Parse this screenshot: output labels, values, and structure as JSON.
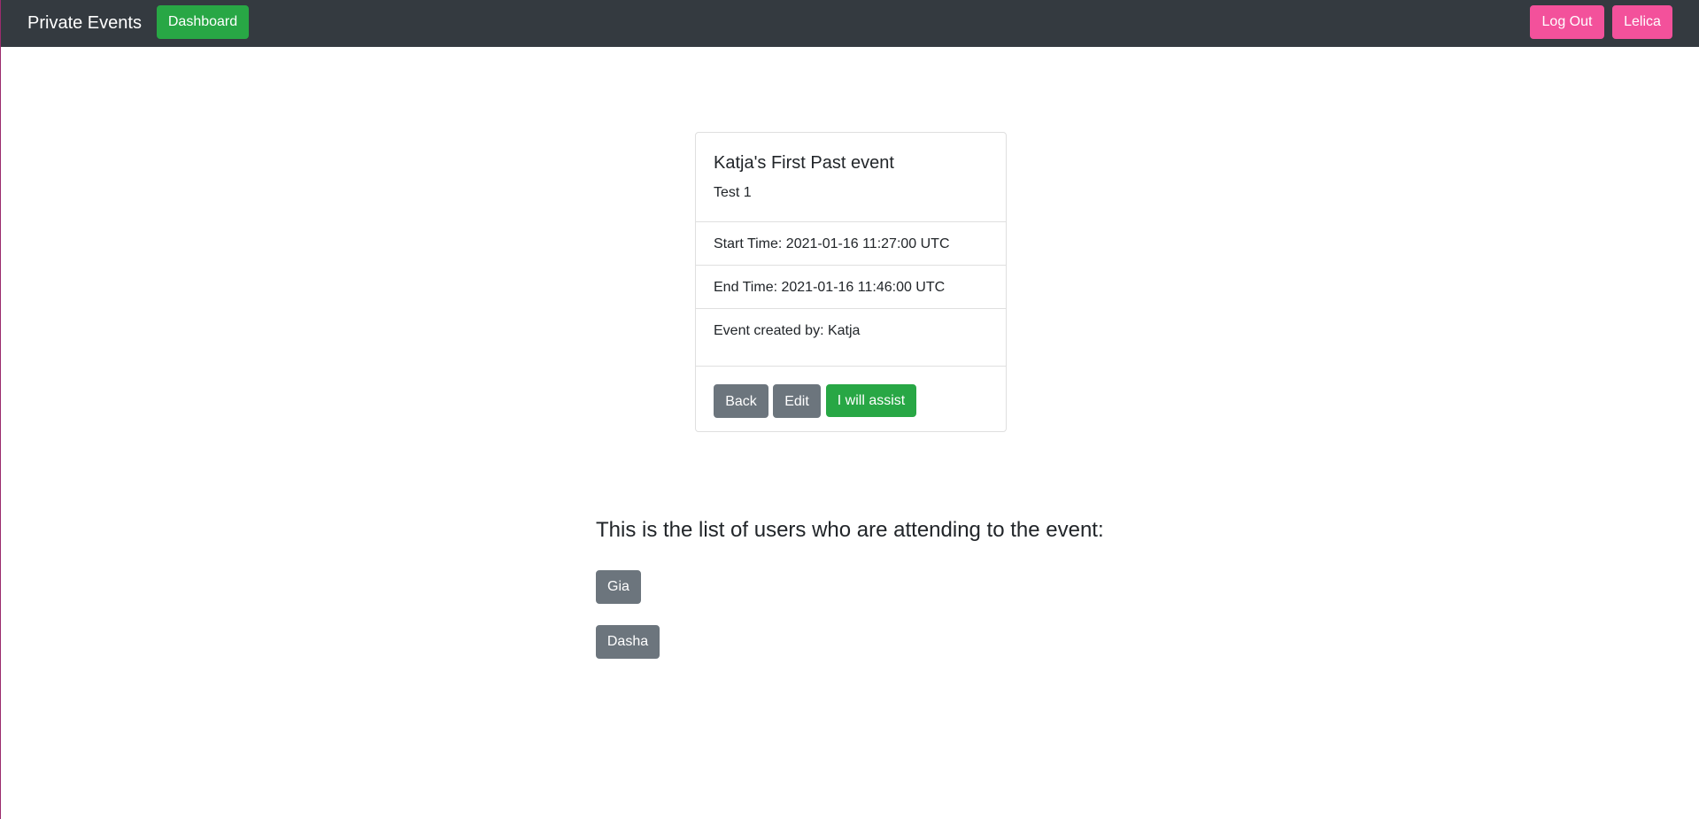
{
  "navbar": {
    "brand": "Private Events",
    "dashboard_label": "Dashboard",
    "logout_label": "Log Out",
    "user_label": "Lelica"
  },
  "event": {
    "title": "Katja's First Past event",
    "description": "Test 1",
    "start_time": "Start Time: 2021-01-16 11:27:00 UTC",
    "end_time": "End Time: 2021-01-16 11:46:00 UTC",
    "created_by": "Event created by: Katja",
    "actions": {
      "back_label": "Back",
      "edit_label": "Edit",
      "assist_label": "I will assist"
    }
  },
  "attendees": {
    "heading": "This is the list of users who are attending to the event:",
    "users": [
      "Gia",
      "Dasha"
    ]
  },
  "colors": {
    "navbar_bg": "#343a40",
    "success": "#28a745",
    "pink": "#f3519b",
    "secondary": "#6c757d"
  }
}
